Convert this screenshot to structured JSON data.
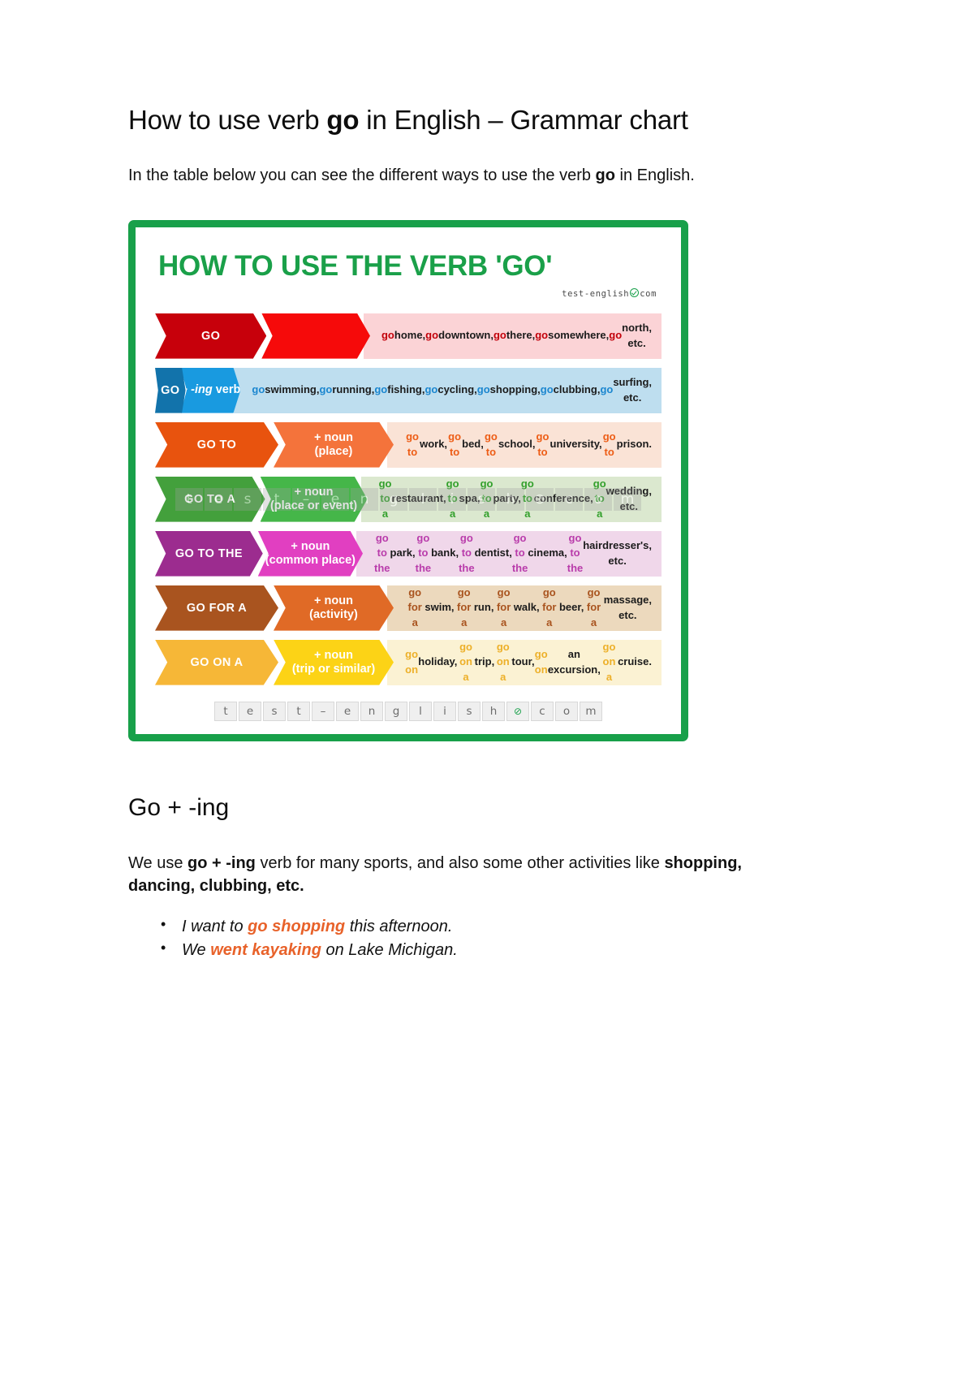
{
  "article": {
    "title_pre": "How to use verb ",
    "title_bold": "go",
    "title_post": " in English – Grammar chart",
    "intro_pre": "In the table below you can see the different ways to use the verb ",
    "intro_bold": "go",
    "intro_post": " in English.",
    "section_title": "Go + -ing",
    "body_pre": "We use ",
    "body_bold1": "go + -ing",
    "body_mid": " verb for many sports, and also some other activities like ",
    "body_bold2": "shopping, dancing, clubbing, etc.",
    "examples": [
      {
        "pre": "I want to ",
        "hl": "go shopping",
        "post": " this afternoon."
      },
      {
        "pre": "We ",
        "hl": "went kayaking",
        "post": " on Lake Michigan."
      }
    ]
  },
  "infographic": {
    "title": "HOW TO USE THE VERB 'GO'",
    "brand_left": "test-english",
    "brand_right": "com",
    "watermark_letters": [
      "t",
      "e",
      "s",
      "t",
      "–",
      "e",
      "n",
      "g",
      "l",
      "i",
      "s",
      "h",
      "⊘",
      "c",
      "o",
      "m"
    ],
    "footer_letters": [
      "t",
      "e",
      "s",
      "t",
      "–",
      "e",
      "n",
      "g",
      "l",
      "i",
      "s",
      "h",
      "⊘",
      "c",
      "o",
      "m"
    ],
    "border_color": "#18a04a",
    "title_color": "#1aa049",
    "rows": [
      {
        "label": "GO",
        "form_line1": "",
        "form_line2": "",
        "examples": "go home, go downtown, go there, go somewhere, go north, etc.",
        "colors": {
          "dark": "#c7000b",
          "mid": "#f60a0a",
          "light": "#fbd3d6",
          "text": "#c2000a"
        }
      },
      {
        "label": "GO",
        "form_line1": "+ -ing verb",
        "form_line2": "",
        "examples": "go swimming, go running, go fishing, go cycling, go shopping, go clubbing, go surfing, etc.",
        "colors": {
          "dark": "#1273ab",
          "mid": "#199ae0",
          "light": "#bedeef",
          "text": "#1b86cf"
        }
      },
      {
        "label": "GO TO",
        "form_line1": "+ noun",
        "form_line2": "(place)",
        "examples": "go to work, go to bed, go to school, go to university, go to prison.",
        "colors": {
          "dark": "#e8530e",
          "mid": "#f4733b",
          "light": "#fae3d6",
          "text": "#ed5d16"
        }
      },
      {
        "label": "GO TO A",
        "form_line1": "+ noun",
        "form_line2": "(place or event)",
        "examples": "go to a restaurant, go to a spa, go to a party, go to a conference, go to a wedding, etc.",
        "colors": {
          "dark": "#43a03c",
          "mid": "#45b649",
          "light": "#dbe8cf",
          "text": "#33a02c"
        }
      },
      {
        "label": "GO TO THE",
        "form_line1": "+ noun",
        "form_line2": "(common place)",
        "examples": "go to the park, go to the bank, go to the dentist, go to the cinema, go to the hairdresser's, etc.",
        "colors": {
          "dark": "#9c2c8f",
          "mid": "#e13fc1",
          "light": "#f0d7ea",
          "text": "#b93cab"
        }
      },
      {
        "label": "GO FOR A",
        "form_line1": "+ noun",
        "form_line2": "(activity)",
        "examples": "go for a swim, go for a run, go for a walk, go for a beer, go for a massage, etc.",
        "colors": {
          "dark": "#a9541f",
          "mid": "#e06a26",
          "light": "#ecd9bd",
          "text": "#a9541f"
        }
      },
      {
        "label": "GO ON A",
        "form_line1": "+ noun",
        "form_line2": "(trip or similar)",
        "examples": "go on holiday, go on a trip, go on a tour, go on an excursion, go on a cruise.",
        "colors": {
          "dark": "#f6b737",
          "mid": "#fcd316",
          "light": "#fbf2d3",
          "text": "#edb029"
        }
      }
    ]
  }
}
